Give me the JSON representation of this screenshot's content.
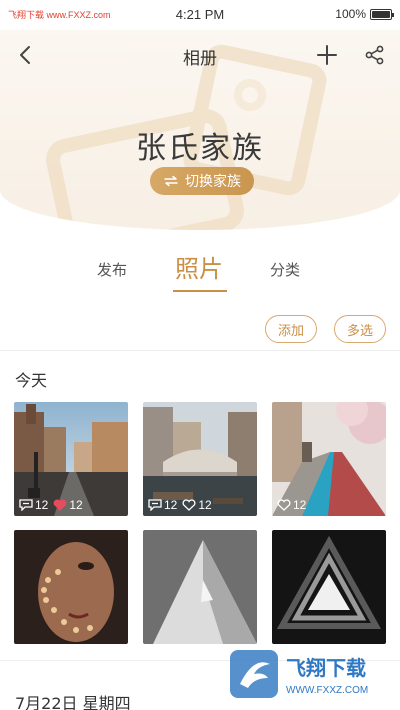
{
  "status_bar": {
    "watermark": "飞翔下载 www.FXXZ.com",
    "time": "4:21 PM",
    "battery": "100%"
  },
  "nav": {
    "title": "相册",
    "back_icon": "chevron-left-icon",
    "add_icon": "plus-icon",
    "share_icon": "share-icon"
  },
  "family": {
    "name": "张氏家族",
    "switch_label": "切换家族"
  },
  "tabs": [
    {
      "label": "发布",
      "active": false
    },
    {
      "label": "照片",
      "active": true
    },
    {
      "label": "分类",
      "active": false
    }
  ],
  "actions": {
    "add_label": "添加",
    "multi_select_label": "多选"
  },
  "sections": [
    {
      "title": "今天",
      "photos": [
        {
          "subject": "city street",
          "comments": "12",
          "likes": "12",
          "liked": true
        },
        {
          "subject": "bridge and canal",
          "comments": "12",
          "likes": "12",
          "liked": false
        },
        {
          "subject": "road with cherry blossoms",
          "likes": "12",
          "liked": false
        },
        {
          "subject": "woman with light pattern"
        },
        {
          "subject": "abstract gray shape"
        },
        {
          "subject": "abstract triangles"
        }
      ]
    },
    {
      "title": "7月22日   星期四"
    }
  ],
  "brand_watermark": {
    "name": "飞翔下载",
    "url": "WWW.FXXZ.COM"
  },
  "colors": {
    "accent": "#c98f46",
    "like": "#e84c5c"
  }
}
